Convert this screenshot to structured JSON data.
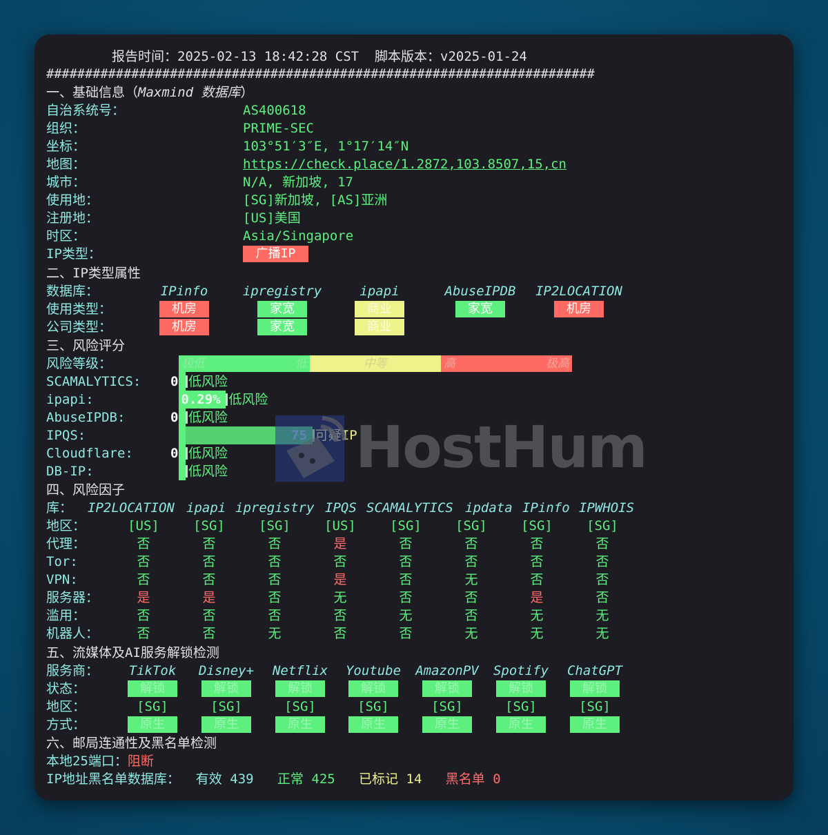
{
  "header": {
    "report_time_label": "报告时间：",
    "report_time": "2025-02-13 18:42:28 CST",
    "script_version_label": "脚本版本：",
    "script_version": "v2025-01-24",
    "separator": "#######################################################################"
  },
  "basic": {
    "title": "一、基础信息（",
    "title_db": "Maxmind 数据库",
    "title_end": "）",
    "rows": [
      {
        "label": "自治系统号：",
        "value": "AS400618"
      },
      {
        "label": "组织：",
        "value": "PRIME-SEC"
      },
      {
        "label": "坐标：",
        "value": "103°51′3″E, 1°17′14″N"
      },
      {
        "label": "地图：",
        "value": "https://check.place/1.2872,103.8507,15,cn"
      },
      {
        "label": "城市：",
        "value": "N/A, 新加坡, 17"
      },
      {
        "label": "使用地：",
        "value": "[SG]新加坡, [AS]亚洲"
      },
      {
        "label": "注册地：",
        "value": "[US]美国"
      },
      {
        "label": "时区：",
        "value": "Asia/Singapore"
      },
      {
        "label": "IP类型：",
        "value": "广播IP"
      }
    ]
  },
  "iptype": {
    "title": "二、IP类型属性",
    "db_label": "数据库：",
    "usage_label": "使用类型：",
    "company_label": "公司类型：",
    "dbs": [
      {
        "name": "IPinfo",
        "usage": "机房",
        "company": "机房",
        "color": "red"
      },
      {
        "name": "ipregistry",
        "usage": "家宽",
        "company": "家宽",
        "color": "green"
      },
      {
        "name": "ipapi",
        "usage": "商业",
        "company": "商业",
        "color": "yellow"
      },
      {
        "name": "AbuseIPDB",
        "usage": "家宽",
        "company": "",
        "color": "green"
      },
      {
        "name": "IP2LOCATION",
        "usage": "机房",
        "company": "",
        "color": "red"
      }
    ]
  },
  "risk": {
    "title": "三、风险评分",
    "level_label": "风险等级：",
    "levels": [
      "极低",
      "低",
      "中等",
      "高",
      "极高"
    ],
    "scores": [
      {
        "label": "SCAMALYTICS:",
        "score": "0",
        "verdict": "低风险",
        "fraction": 0.0,
        "color": "green"
      },
      {
        "label": "ipapi:",
        "score": "0.29%",
        "verdict": "低风险",
        "fraction": 0.12,
        "color": "green"
      },
      {
        "label": "AbuseIPDB:",
        "score": "0",
        "verdict": "低风险",
        "fraction": 0.0,
        "color": "green"
      },
      {
        "label": "IPQS:",
        "score": "75",
        "verdict": "可疑IP",
        "fraction": 0.34,
        "color": "yellow"
      },
      {
        "label": "Cloudflare:",
        "score": "0",
        "verdict": "低风险",
        "fraction": 0.0,
        "color": "green"
      },
      {
        "label": "DB-IP:",
        "score": "",
        "verdict": "低风险",
        "fraction": 0.0,
        "color": "green"
      }
    ]
  },
  "factors": {
    "title": "四、风险因子",
    "lib_label": "库：",
    "libs": [
      "IP2LOCATION",
      "ipapi",
      "ipregistry",
      "IPQS",
      "SCAMALYTICS",
      "ipdata",
      "IPinfo",
      "IPWHOIS"
    ],
    "rows": [
      {
        "label": "地区：",
        "values": [
          "[US]",
          "[SG]",
          "[SG]",
          "[US]",
          "[SG]",
          "[SG]",
          "[SG]",
          "[SG]"
        ]
      },
      {
        "label": "代理：",
        "values": [
          "否",
          "否",
          "否",
          "是",
          "否",
          "否",
          "否",
          "否"
        ]
      },
      {
        "label": "Tor:",
        "values": [
          "否",
          "否",
          "否",
          "否",
          "否",
          "否",
          "否",
          "否"
        ]
      },
      {
        "label": "VPN:",
        "values": [
          "否",
          "否",
          "否",
          "是",
          "否",
          "无",
          "否",
          "否"
        ]
      },
      {
        "label": "服务器：",
        "values": [
          "是",
          "是",
          "否",
          "无",
          "否",
          "否",
          "是",
          "否"
        ]
      },
      {
        "label": "滥用：",
        "values": [
          "否",
          "否",
          "否",
          "否",
          "无",
          "否",
          "无",
          "无"
        ]
      },
      {
        "label": "机器人：",
        "values": [
          "否",
          "否",
          "无",
          "否",
          "否",
          "无",
          "无",
          "无"
        ]
      }
    ]
  },
  "streaming": {
    "title": "五、流媒体及AI服务解锁检测",
    "provider_label": "服务商：",
    "status_label": "状态：",
    "region_label": "地区：",
    "method_label": "方式：",
    "services": [
      {
        "name": "TikTok",
        "status": "解锁",
        "region": "[SG]",
        "method": "原生"
      },
      {
        "name": "Disney+",
        "status": "解锁",
        "region": "[SG]",
        "method": "原生"
      },
      {
        "name": "Netflix",
        "status": "解锁",
        "region": "[SG]",
        "method": "原生"
      },
      {
        "name": "Youtube",
        "status": "解锁",
        "region": "[SG]",
        "method": "原生"
      },
      {
        "name": "AmazonPV",
        "status": "解锁",
        "region": "[SG]",
        "method": "原生"
      },
      {
        "name": "Spotify",
        "status": "解锁",
        "region": "[SG]",
        "method": "原生"
      },
      {
        "name": "ChatGPT",
        "status": "解锁",
        "region": "[SG]",
        "method": "原生"
      }
    ]
  },
  "mail": {
    "title": "六、邮局连通性及黑名单检测",
    "port_label": "本地25端口：",
    "port_value": "阻断",
    "blacklist_label": "IP地址黑名单数据库：",
    "valid_label": "有效",
    "valid": "439",
    "normal_label": "正常",
    "normal": "425",
    "marked_label": "已标记",
    "marked": "14",
    "black_label": "黑名单",
    "black": "0"
  },
  "watermark": {
    "text": "HostHum"
  },
  "colors": {
    "green": "#5ef07f",
    "red": "#ff6b62",
    "yellow": "#eef28a",
    "cyan": "#8fe8e1",
    "background": "#1c1c22"
  }
}
